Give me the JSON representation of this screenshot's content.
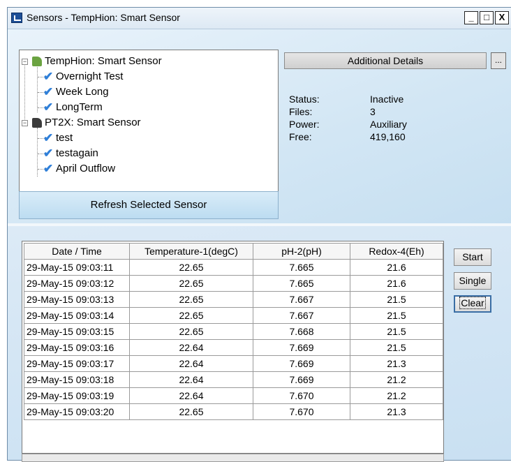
{
  "window": {
    "title": "Sensors - TempHion: Smart Sensor",
    "controls": {
      "minimize": "_",
      "maximize": "□",
      "close": "X"
    }
  },
  "tree": {
    "devices": [
      {
        "label": "TempHion:  Smart Sensor",
        "expanded": true,
        "children": [
          "Overnight Test",
          "Week Long",
          "LongTerm"
        ]
      },
      {
        "label": "PT2X: Smart Sensor",
        "expanded": true,
        "children": [
          "test",
          "testagain",
          "April Outflow"
        ]
      }
    ]
  },
  "refresh_button": "Refresh Selected Sensor",
  "details": {
    "button_label": "Additional Details",
    "ellipsis_label": "...",
    "fields": [
      {
        "label": "Status:",
        "value": "Inactive"
      },
      {
        "label": "Files:",
        "value": "3"
      },
      {
        "label": "Power:",
        "value": "Auxiliary"
      },
      {
        "label": "Free:",
        "value": "419,160"
      }
    ]
  },
  "readings": {
    "columns": [
      "Date / Time",
      "Temperature-1(degC)",
      "pH-2(pH)",
      "Redox-4(Eh)"
    ],
    "rows": [
      [
        "29-May-15 09:03:11",
        "22.65",
        "7.665",
        "21.6"
      ],
      [
        "29-May-15 09:03:12",
        "22.65",
        "7.665",
        "21.6"
      ],
      [
        "29-May-15 09:03:13",
        "22.65",
        "7.667",
        "21.5"
      ],
      [
        "29-May-15 09:03:14",
        "22.65",
        "7.667",
        "21.5"
      ],
      [
        "29-May-15 09:03:15",
        "22.65",
        "7.668",
        "21.5"
      ],
      [
        "29-May-15 09:03:16",
        "22.64",
        "7.669",
        "21.5"
      ],
      [
        "29-May-15 09:03:17",
        "22.64",
        "7.669",
        "21.3"
      ],
      [
        "29-May-15 09:03:18",
        "22.64",
        "7.669",
        "21.2"
      ],
      [
        "29-May-15 09:03:19",
        "22.64",
        "7.670",
        "21.2"
      ],
      [
        "29-May-15 09:03:20",
        "22.65",
        "7.670",
        "21.3"
      ]
    ]
  },
  "actions": {
    "start": "Start",
    "single": "Single",
    "clear": "Clear"
  }
}
